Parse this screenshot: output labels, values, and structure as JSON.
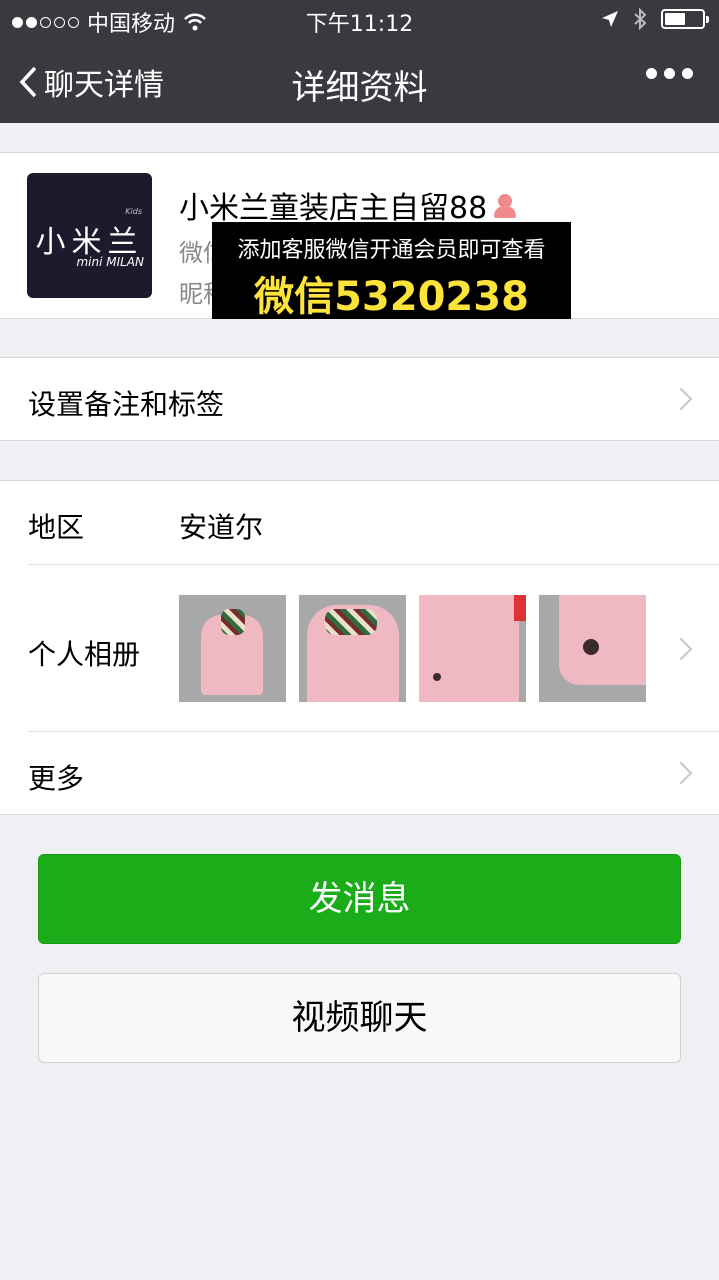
{
  "status_bar": {
    "carrier": "中国移动",
    "time": "下午11:12",
    "signal_bars_filled": 2,
    "signal_bars_total": 5,
    "battery_level": 0.55
  },
  "nav": {
    "back_label": "聊天详情",
    "title": "详细资料",
    "more_icon": "more-dots-icon"
  },
  "profile": {
    "avatar_text": "小米兰",
    "avatar_subtext": "mini MILAN",
    "avatar_kids": "Kids",
    "name": "小米兰童装店主自留88",
    "gender_icon": "female-icon",
    "wechat_id_label_partial": "微信",
    "nickname_label_partial": "昵称"
  },
  "overlay": {
    "line1": "添加客服微信开通会员即可查看",
    "line2": "微信5320238",
    "line2_color": "#fde33a"
  },
  "remark_row": {
    "label": "设置备注和标签"
  },
  "region_row": {
    "label": "地区",
    "value": "安道尔"
  },
  "album_row": {
    "label": "个人相册",
    "photo_count": 4
  },
  "more_row": {
    "label": "更多"
  },
  "buttons": {
    "message": "发消息",
    "video_chat": "视频聊天"
  },
  "colors": {
    "nav_bg": "#393a3f",
    "primary_green": "#1aad19",
    "page_bg": "#efeff4"
  }
}
